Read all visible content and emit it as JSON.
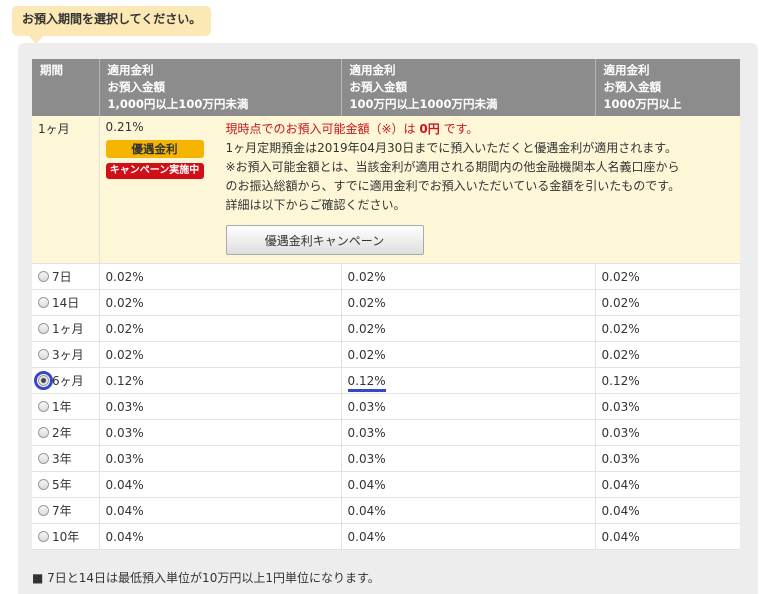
{
  "heading": "お預入期間を選択してください。",
  "columns": {
    "period": "期間",
    "c1": [
      "適用金利",
      "お預入金額",
      "1,000円以上100万円未満"
    ],
    "c2": [
      "適用金利",
      "お預入金額",
      "100万円以上1000万円未満"
    ],
    "c3": [
      "適用金利",
      "お預入金額",
      "1000万円以上"
    ]
  },
  "special": {
    "period": "1ヶ月",
    "rate": "0.21%",
    "badge_preferential": "優遇金利",
    "badge_campaign": "キャンペーン実施中",
    "notice_prefix": "現時点でのお預入可能金額（※）は",
    "notice_amount": "0円",
    "notice_suffix": "です。",
    "line2": "1ヶ月定期預金は2019年04月30日までに預入いただくと優遇金利が適用されます。",
    "line3": "※お預入可能金額とは、当該金利が適用される期間内の他金融機関本人名義口座から",
    "line4": "のお振込総額から、すでに適用金利でお預入いただいている金額を引いたものです。",
    "line5": "詳細は以下からご確認ください。",
    "button": "優遇金利キャンペーン"
  },
  "rows": [
    {
      "period": "7日",
      "r1": "0.02%",
      "r2": "0.02%",
      "r3": "0.02%"
    },
    {
      "period": "14日",
      "r1": "0.02%",
      "r2": "0.02%",
      "r3": "0.02%"
    },
    {
      "period": "1ヶ月",
      "r1": "0.02%",
      "r2": "0.02%",
      "r3": "0.02%"
    },
    {
      "period": "3ヶ月",
      "r1": "0.02%",
      "r2": "0.02%",
      "r3": "0.02%"
    },
    {
      "period": "6ヶ月",
      "r1": "0.12%",
      "r2": "0.12%",
      "r3": "0.12%"
    },
    {
      "period": "1年",
      "r1": "0.03%",
      "r2": "0.03%",
      "r3": "0.03%"
    },
    {
      "period": "2年",
      "r1": "0.03%",
      "r2": "0.03%",
      "r3": "0.03%"
    },
    {
      "period": "3年",
      "r1": "0.03%",
      "r2": "0.03%",
      "r3": "0.03%"
    },
    {
      "period": "5年",
      "r1": "0.04%",
      "r2": "0.04%",
      "r3": "0.04%"
    },
    {
      "period": "7年",
      "r1": "0.04%",
      "r2": "0.04%",
      "r3": "0.04%"
    },
    {
      "period": "10年",
      "r1": "0.04%",
      "r2": "0.04%",
      "r3": "0.04%"
    }
  ],
  "selected_period": "6ヶ月",
  "footnote": "■ 7日と14日は最低預入単位が10万円以上1円単位になります。",
  "colors": {
    "header": "#8c8c8c",
    "special_bg": "#fdf7d8",
    "selection": "#3747c9",
    "badge_red": "#d10f18",
    "badge_yellow": "#f5b400"
  }
}
